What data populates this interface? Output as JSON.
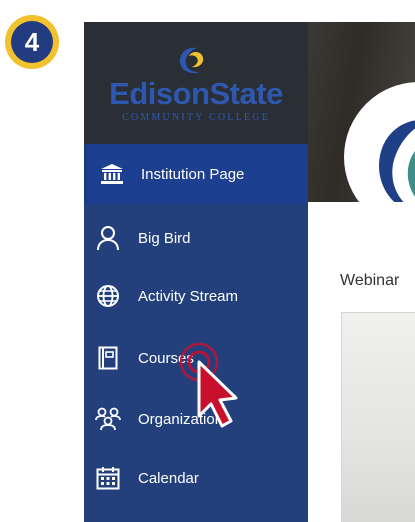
{
  "step": {
    "number": "4"
  },
  "logo": {
    "name": "EdisonState",
    "subtitle": "COMMUNITY COLLEGE"
  },
  "nav": {
    "items": [
      {
        "label": "Institution Page",
        "icon": "institution-icon",
        "active": true
      },
      {
        "label": "Big Bird",
        "icon": "user-icon"
      },
      {
        "label": "Activity Stream",
        "icon": "globe-icon"
      },
      {
        "label": "Courses",
        "icon": "courses-icon"
      },
      {
        "label": "Organizations",
        "icon": "organizations-icon"
      },
      {
        "label": "Calendar",
        "icon": "calendar-icon"
      }
    ]
  },
  "main": {
    "section_title": "Webinar"
  },
  "colors": {
    "sidebar": "#23407d",
    "active_item": "#1d3f8f",
    "logo_bg": "#2a2f36",
    "badge_ring": "#f2c12e",
    "badge_fill": "#233b80",
    "pointer": "#c8102e",
    "logo_teal": "#3e8f87",
    "logo_navy": "#1f3f87"
  }
}
